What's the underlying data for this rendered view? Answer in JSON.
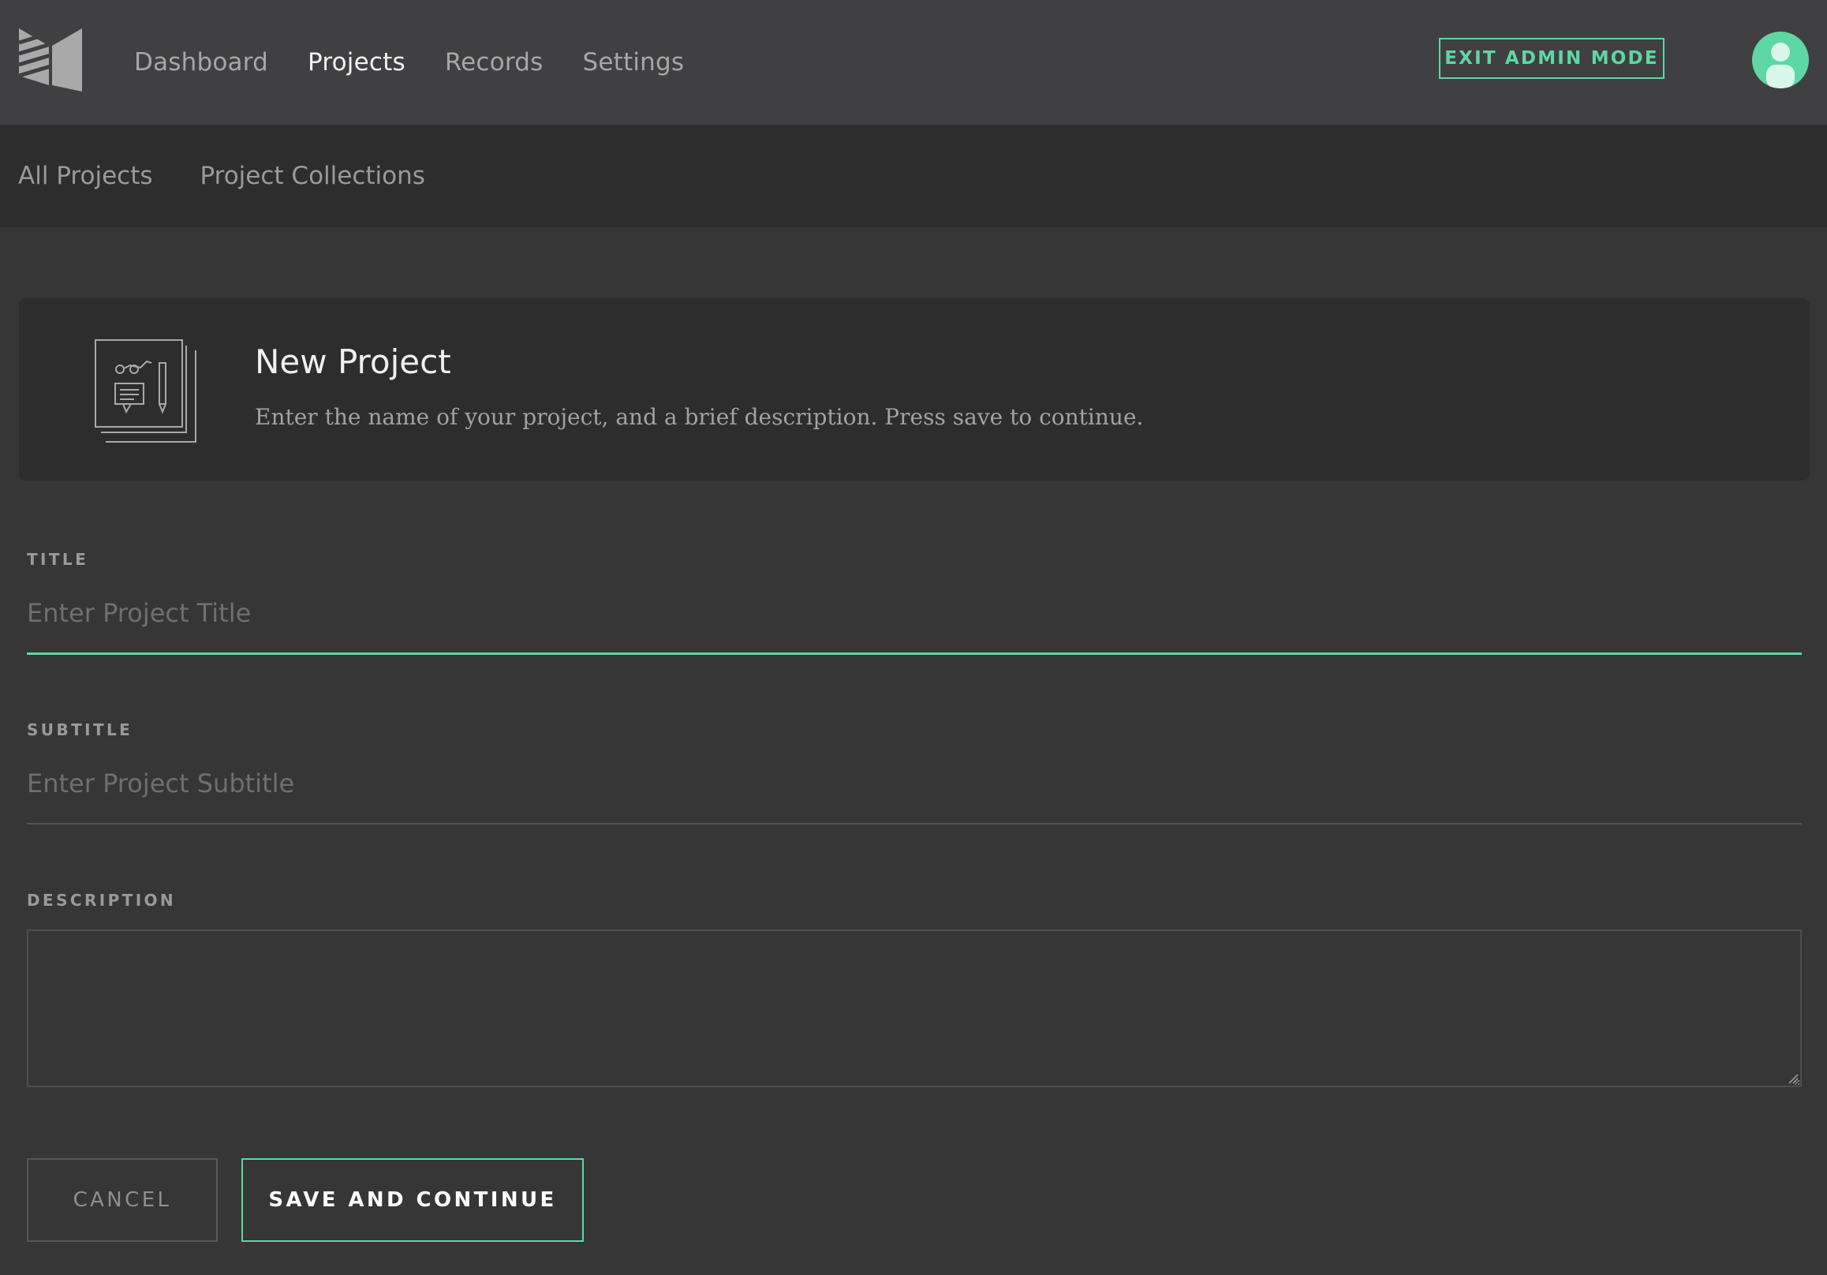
{
  "colors": {
    "accent": "#5ed7a4",
    "topbar_bg": "#404042",
    "subnav_bg": "#2d2d2d",
    "page_bg": "#363636"
  },
  "topnav": {
    "logo_icon": "book-logo-icon",
    "items": [
      {
        "label": "Dashboard",
        "active": false
      },
      {
        "label": "Projects",
        "active": true
      },
      {
        "label": "Records",
        "active": false
      },
      {
        "label": "Settings",
        "active": false
      }
    ],
    "exit_admin_label": "EXIT ADMIN MODE",
    "avatar_icon": "user-avatar-icon"
  },
  "subnav": {
    "items": [
      {
        "label": "All Projects"
      },
      {
        "label": "Project Collections"
      }
    ]
  },
  "card": {
    "icon": "project-documents-icon",
    "title": "New Project",
    "description": "Enter the name of your project, and a brief description. Press save to continue."
  },
  "form": {
    "title_label": "TITLE",
    "title_placeholder": "Enter Project Title",
    "title_value": "",
    "subtitle_label": "SUBTITLE",
    "subtitle_placeholder": "Enter Project Subtitle",
    "subtitle_value": "",
    "description_label": "DESCRIPTION",
    "description_value": ""
  },
  "actions": {
    "cancel_label": "CANCEL",
    "save_label": "SAVE AND CONTINUE"
  }
}
